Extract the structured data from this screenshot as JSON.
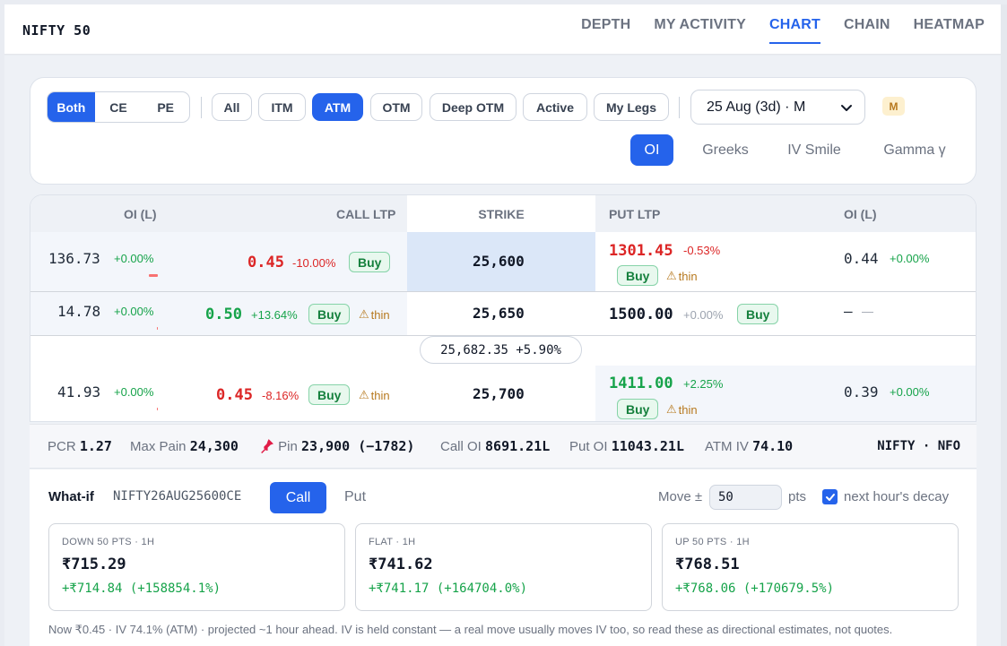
{
  "header": {
    "title": "NIFTY 50",
    "tabs": [
      {
        "label": "DEPTH"
      },
      {
        "label": "MY ACTIVITY"
      },
      {
        "label": "CHART"
      },
      {
        "label": "CHAIN"
      },
      {
        "label": "HEATMAP"
      }
    ],
    "active_tab": "CHART"
  },
  "filters": {
    "side_segments": [
      "Both",
      "CE",
      "PE"
    ],
    "moneyness": [
      "All",
      "ITM",
      "ATM",
      "OTM",
      "Deep OTM",
      "Active",
      "My Legs"
    ],
    "active_moneyness": "ATM",
    "expiry_select": "25 Aug (3d) · M",
    "expiry_badge": "M",
    "views": [
      "OI",
      "Greeks",
      "IV Smile",
      "Gamma γ"
    ],
    "active_view": "OI"
  },
  "table": {
    "headers": {
      "call_oi": "OI (L)",
      "call_ltp": "CALL LTP",
      "strike": "STRIKE",
      "put_ltp": "PUT LTP",
      "put_oi": "OI (L)"
    },
    "buy_label": "Buy",
    "thin_label": "thin",
    "rows": [
      {
        "call_oi": "136.73",
        "call_oi_chg": "+0.00%",
        "call_ltp": "0.45",
        "call_chg": "-10.00%",
        "strike": "25,600",
        "put_ltp": "1301.45",
        "put_chg": "-0.53%",
        "put_oi": "0.44",
        "put_oi_chg": "+0.00%"
      },
      {
        "call_oi": "14.78",
        "call_oi_chg": "+0.00%",
        "call_ltp": "0.50",
        "call_chg": "+13.64%",
        "strike": "25,650",
        "put_ltp": "1500.00",
        "put_chg": "+0.00%",
        "put_oi": "—",
        "put_oi_chg": "—"
      },
      {
        "call_oi": "41.93",
        "call_oi_chg": "+0.00%",
        "call_ltp": "0.45",
        "call_chg": "-8.16%",
        "strike": "25,700",
        "put_ltp": "1411.00",
        "put_chg": "+2.25%",
        "put_oi": "0.39",
        "put_oi_chg": "+0.00%"
      }
    ],
    "spot": "25,682.35 +5.90%"
  },
  "stats": {
    "pcr_label": "PCR",
    "pcr": "1.27",
    "maxpain_label": "Max Pain",
    "maxpain": "24,300",
    "pin_label": "Pin",
    "pin": "23,900 (−1782)",
    "calloi_label": "Call OI",
    "calloi": "8691.21L",
    "putoi_label": "Put OI",
    "putoi": "11043.21L",
    "atmiv_label": "ATM IV",
    "atmiv": "74.10",
    "exchange": "NIFTY · NFO"
  },
  "whatif": {
    "label": "What-if",
    "symbol": "NIFTY26AUG25600CE",
    "call_label": "Call",
    "put_label": "Put",
    "move_label": "Move ±",
    "move_value": "50",
    "pts_label": "pts",
    "decay_label": "next hour's decay",
    "decay_checked": true,
    "scenarios": [
      {
        "header": "DOWN 50 PTS · 1H",
        "value": "₹715.29",
        "delta": "+₹714.84 (+158854.1%)"
      },
      {
        "header": "FLAT · 1H",
        "value": "₹741.62",
        "delta": "+₹741.17 (+164704.0%)"
      },
      {
        "header": "UP 50 PTS · 1H",
        "value": "₹768.51",
        "delta": "+₹768.06 (+170679.5%)"
      }
    ],
    "footnote": "Now ₹0.45 · IV 74.1% (ATM) · projected ~1 hour ahead. IV is held constant — a real move usually moves IV too, so read these as directional estimates, not quotes."
  },
  "colors": {
    "accent": "#2563eb",
    "up": "#16a34a",
    "down": "#dc2626",
    "warn": "#b7791f"
  }
}
